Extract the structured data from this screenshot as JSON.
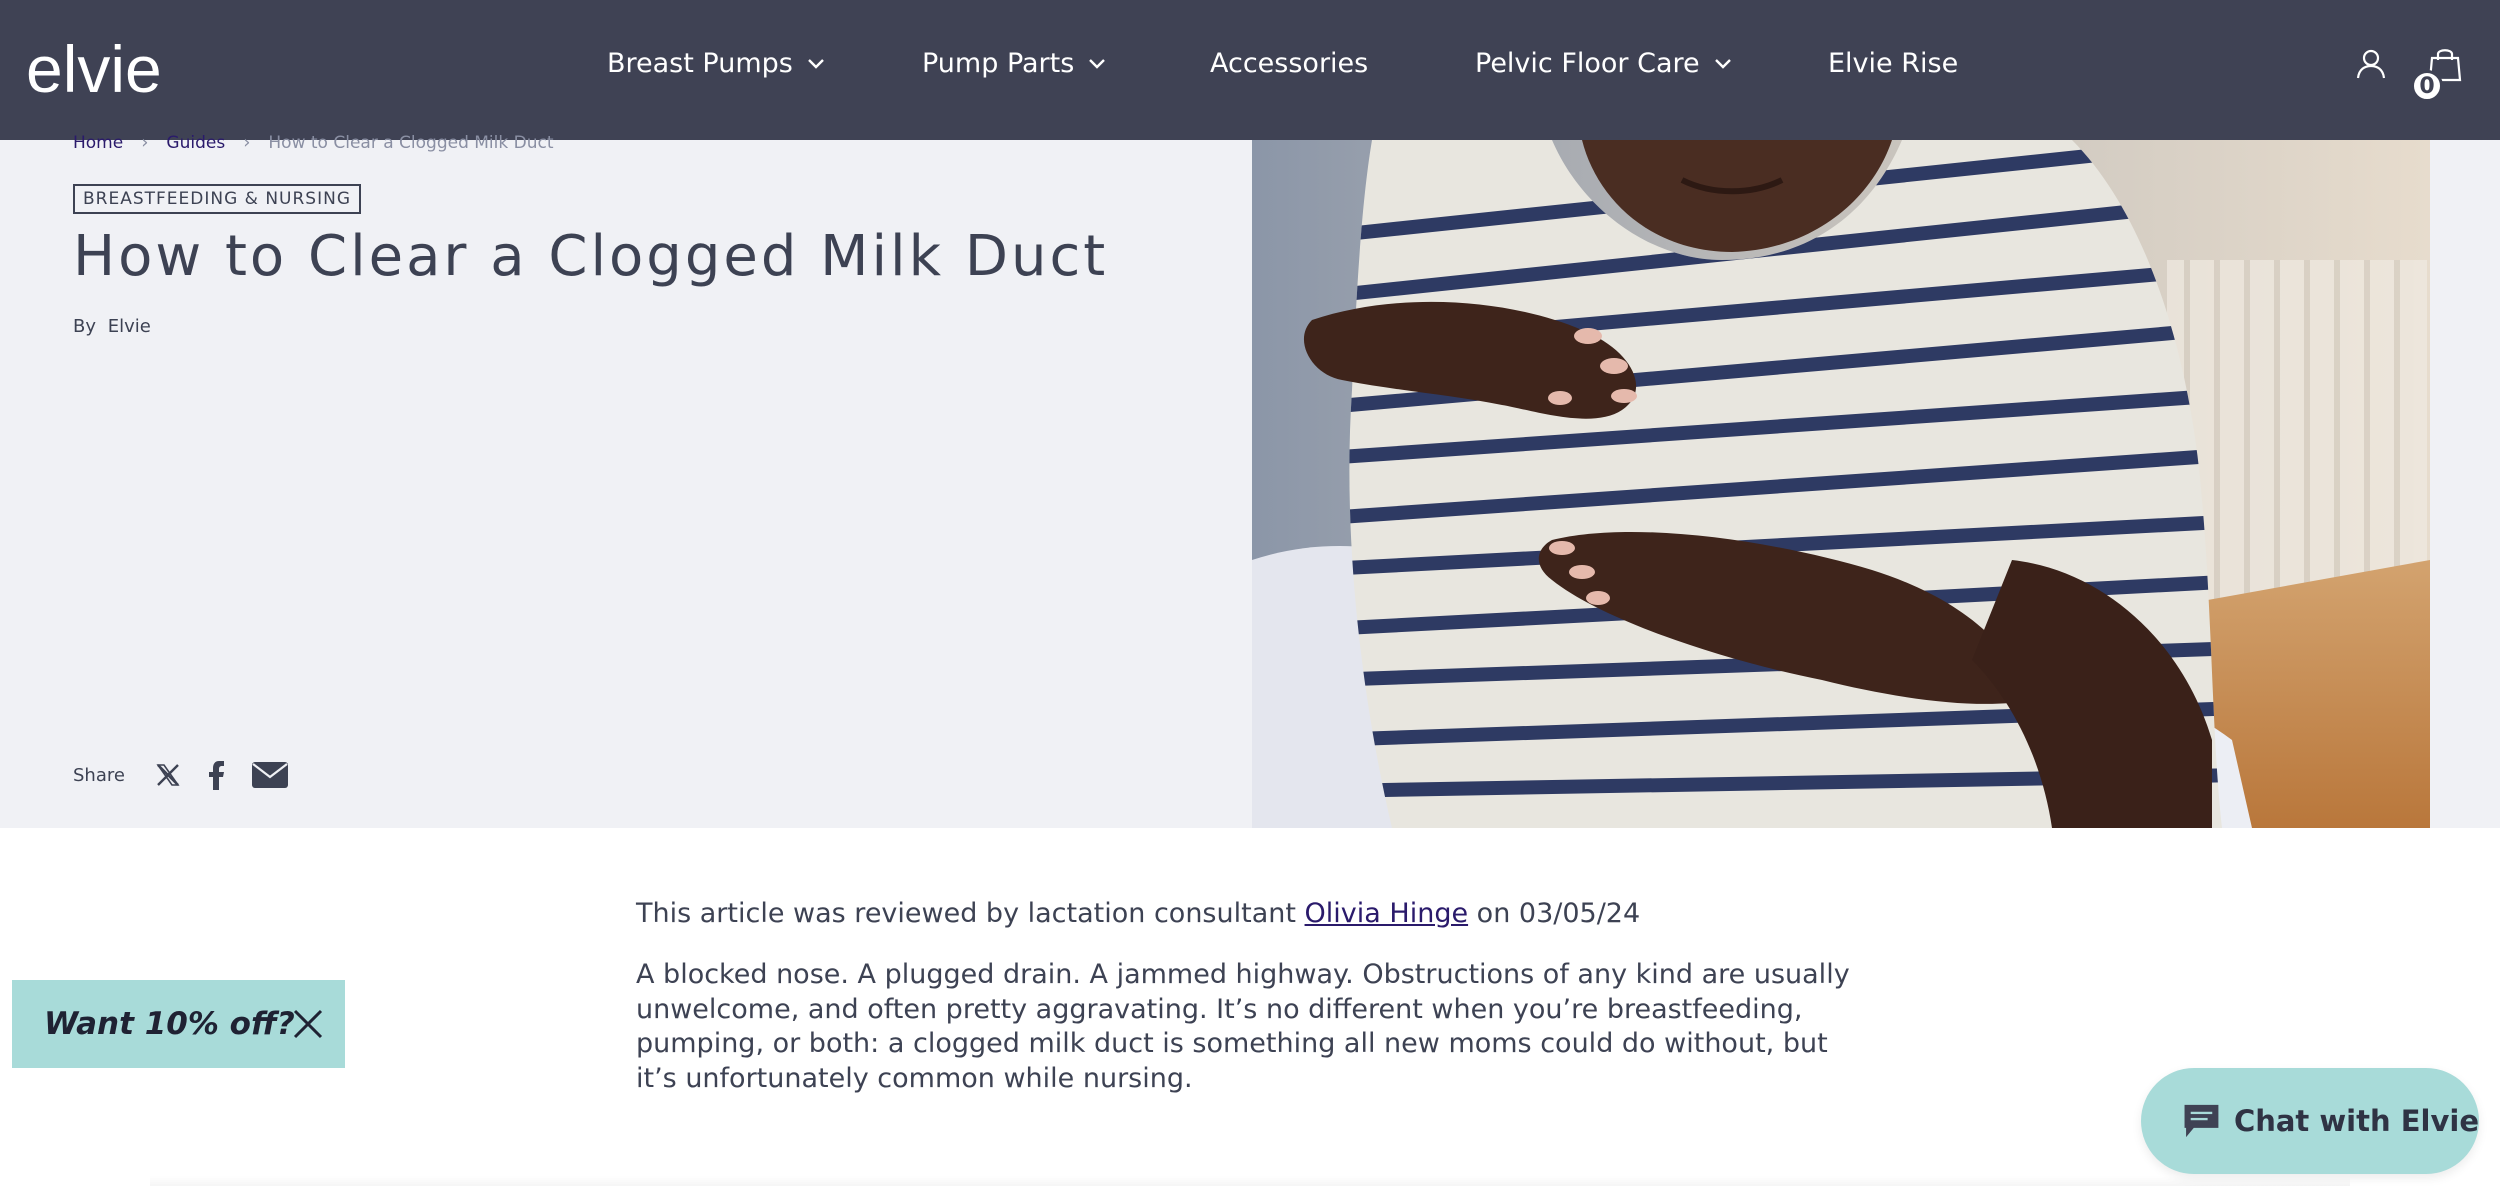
{
  "brand": {
    "logo_text": "elvie"
  },
  "nav": {
    "items": [
      {
        "label": "Breast Pumps",
        "has_dropdown": true
      },
      {
        "label": "Pump Parts",
        "has_dropdown": true
      },
      {
        "label": "Accessories",
        "has_dropdown": false
      },
      {
        "label": "Pelvic Floor Care",
        "has_dropdown": true
      },
      {
        "label": "Elvie Rise",
        "has_dropdown": false
      }
    ],
    "account_icon": "user-icon",
    "cart_icon": "shopping-bag-icon",
    "cart_count": "0"
  },
  "breadcrumb": {
    "items": [
      "Home",
      "Guides",
      "How to Clear a Clogged Milk Duct"
    ],
    "separator_icon": "chevron-right-icon"
  },
  "article": {
    "category": "BREASTFEEDING & NURSING",
    "title": "How to Clear a Clogged Milk Duct",
    "by_label": "By",
    "author": "Elvie",
    "share_label": "Share",
    "share_icons": [
      "x-twitter-icon",
      "facebook-icon",
      "email-icon"
    ],
    "review_prefix": "This article was reviewed by lactation consultant",
    "reviewer": "Olivia Hinge",
    "review_suffix": "on 03/05/24",
    "intro": "A blocked nose. A plugged drain. A jammed highway. Obstructions of any kind are usually unwelcome, and often pretty aggravating. It’s no different when you’re breastfeeding, pumping, or both: a clogged milk duct is something all new moms could do without, but it’s unfortunately common while nursing."
  },
  "promo": {
    "label": "Want 10% off?",
    "close_icon": "close-icon"
  },
  "chat": {
    "label": "Chat with Elvie",
    "icon": "chat-bubble-icon"
  },
  "colors": {
    "header_bg": "#3f4254",
    "hero_bg": "#f0f1f5",
    "accent_teal": "#a8dbd9",
    "text": "#3d4253",
    "link": "#2a1a6b"
  }
}
